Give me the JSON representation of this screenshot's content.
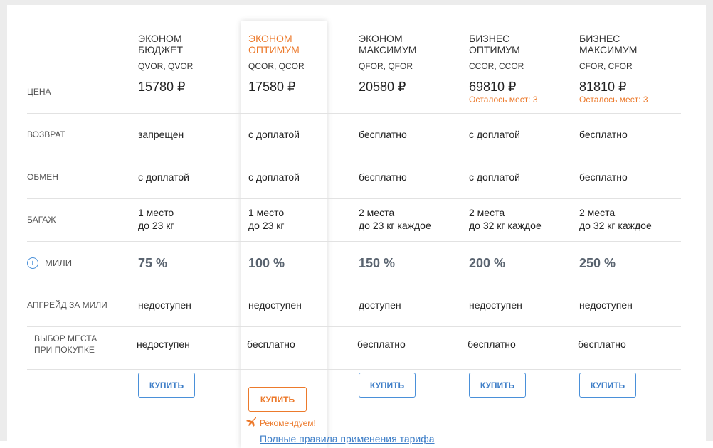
{
  "tariffs": [
    {
      "name": "ЭКОНОМ БЮДЖЕТ",
      "codes": "QVOR, QVOR",
      "price": "15780 ₽",
      "seats_left": "",
      "refund": "запрещен",
      "exchange": "с доплатой",
      "baggage_line1": "1 место",
      "baggage_line2": "до 23 кг",
      "miles": "75 %",
      "upgrade": "недоступен",
      "seat_selection": "недоступен",
      "buy_label": "КУПИТЬ"
    },
    {
      "name": "ЭКОНОМ ОПТИМУМ",
      "codes": "QCOR, QCOR",
      "price": "17580 ₽",
      "seats_left": "",
      "refund": "с доплатой",
      "exchange": "с доплатой",
      "baggage_line1": "1 место",
      "baggage_line2": "до 23 кг",
      "miles": "100 %",
      "upgrade": "недоступен",
      "seat_selection": "бесплатно",
      "buy_label": "КУПИТЬ"
    },
    {
      "name": "ЭКОНОМ МАКСИМУМ",
      "codes": "QFOR, QFOR",
      "price": "20580 ₽",
      "seats_left": "",
      "refund": "бесплатно",
      "exchange": "бесплатно",
      "baggage_line1": "2 места",
      "baggage_line2": "до 23 кг каждое",
      "miles": "150 %",
      "upgrade": "доступен",
      "seat_selection": "бесплатно",
      "buy_label": "КУПИТЬ"
    },
    {
      "name": "БИЗНЕС ОПТИМУМ",
      "codes": "CCOR, CCOR",
      "price": "69810 ₽",
      "seats_left": "Осталось мест: 3",
      "refund": "с доплатой",
      "exchange": "с доплатой",
      "baggage_line1": "2 места",
      "baggage_line2": "до 32 кг каждое",
      "miles": "200 %",
      "upgrade": "недоступен",
      "seat_selection": "бесплатно",
      "buy_label": "КУПИТЬ"
    },
    {
      "name": "БИЗНЕС МАКСИМУМ",
      "codes": "CFOR, CFOR",
      "price": "81810 ₽",
      "seats_left": "Осталось мест: 3",
      "refund": "бесплатно",
      "exchange": "бесплатно",
      "baggage_line1": "2 места",
      "baggage_line2": "до 32 кг каждое",
      "miles": "250 %",
      "upgrade": "недоступен",
      "seat_selection": "бесплатно",
      "buy_label": "КУПИТЬ"
    }
  ],
  "row_labels": {
    "price": "ЦЕНА",
    "refund": "ВОЗВРАТ",
    "exchange": "ОБМЕН",
    "baggage": "БАГАЖ",
    "miles": "МИЛИ",
    "upgrade": "АПГРЕЙД ЗА МИЛИ",
    "seat_selection": "ВЫБОР МЕСТА ПРИ ПОКУПКЕ"
  },
  "recommended_label": "Рекомендуем!",
  "rules_link": "Полные правила применения тарифа",
  "colors": {
    "accent_orange": "#ec7a2c",
    "link_blue": "#3f7fc8"
  },
  "icons": {
    "info": "info-icon",
    "recommended": "plane-icon"
  }
}
